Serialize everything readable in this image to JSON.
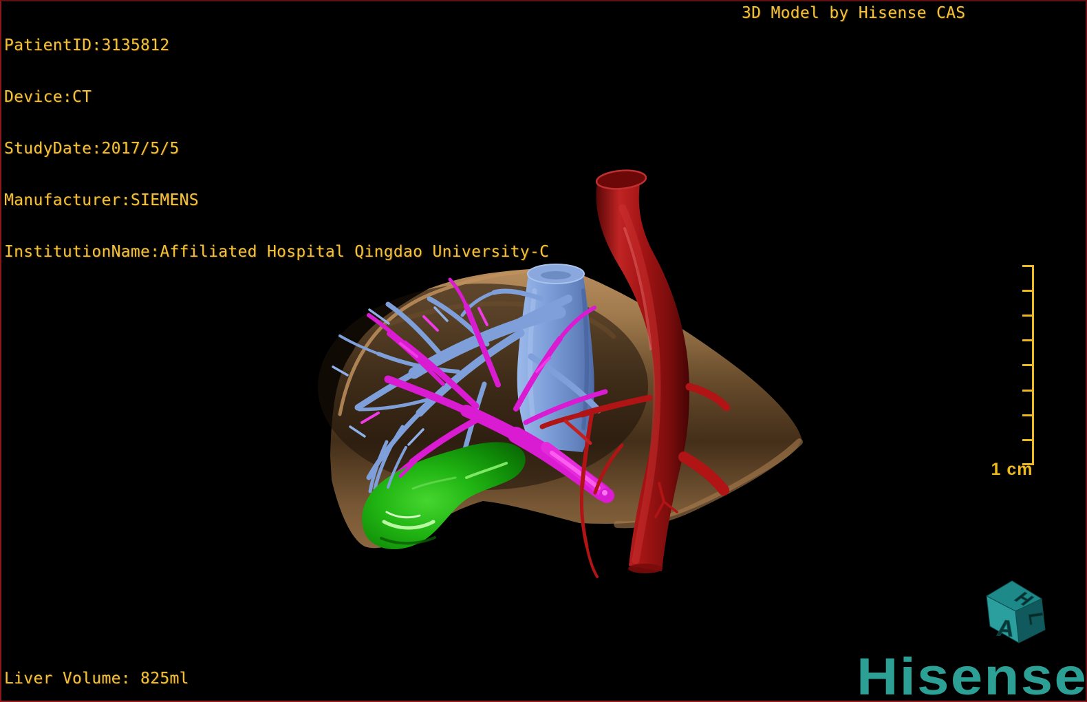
{
  "viewport": {
    "patient_info": [
      "PatientID:3135812",
      "Device:CT",
      "StudyDate:2017/5/5",
      "Manufacturer:SIEMENS",
      "InstitutionName:Affiliated Hospital Qingdao University-C"
    ],
    "watermark": "3D Model by Hisense CAS",
    "liver_volume": "Liver Volume: 825ml"
  },
  "scale_bar": {
    "label": "1 cm",
    "ticks": 9
  },
  "orientation_cube": {
    "top_letter": "H",
    "front_letter": "A",
    "right_letter": "L"
  },
  "brand": {
    "logo": "Hisense"
  },
  "colors": {
    "overlay_text": "#F0C33C",
    "scale_bar": "#EDB91C",
    "brand_teal": "#2CA094",
    "cube_teal": "#1D8989",
    "liver_tan": "#A97E50",
    "vein_blue": "#7E9FD9",
    "portal_magenta": "#D91BD1",
    "artery_red": "#A31414",
    "gallbladder_green": "#1BA90F",
    "background": "#000000",
    "frame_border": "#7A1414"
  },
  "structures": [
    {
      "name": "liver",
      "color": "#A97E50"
    },
    {
      "name": "hepatic-veins",
      "color": "#7E9FD9"
    },
    {
      "name": "portal-vein",
      "color": "#D91BD1"
    },
    {
      "name": "aorta-hepatic-artery",
      "color": "#A31414"
    },
    {
      "name": "gallbladder",
      "color": "#1BA90F"
    }
  ]
}
